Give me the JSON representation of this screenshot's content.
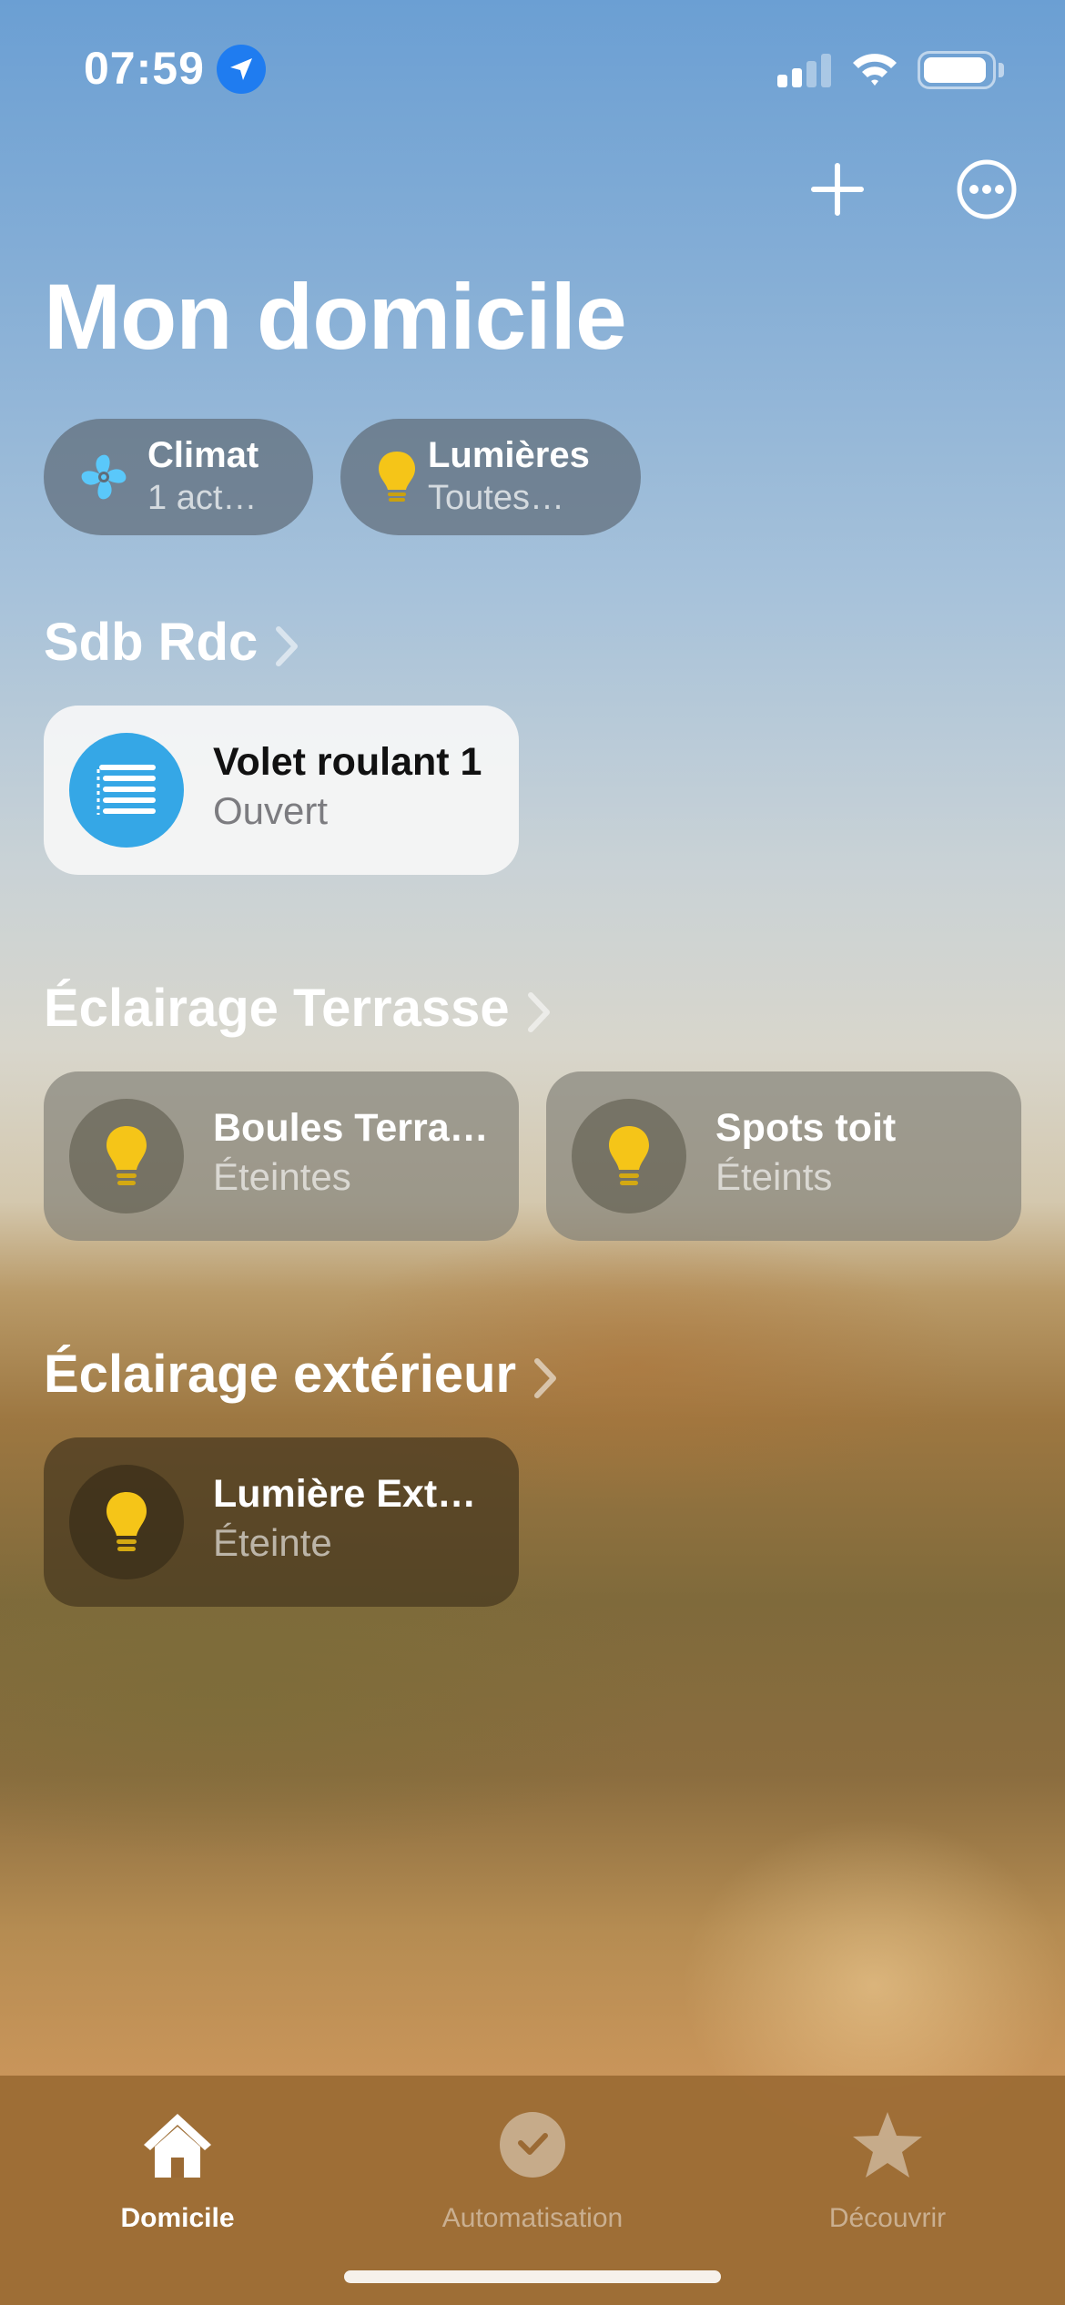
{
  "status_bar": {
    "time": "07:59",
    "signal_bars_active": 2,
    "signal_bars_total": 4,
    "battery_level": 0.95
  },
  "header": {
    "title": "Mon domicile",
    "add_icon": "plus-icon",
    "more_icon": "ellipsis-circle-icon"
  },
  "chips": [
    {
      "title": "Climat",
      "subtitle": "1 act…",
      "icon": "fan-icon"
    },
    {
      "title": "Lumières",
      "subtitle": "Toutes…",
      "icon": "lightbulb-icon"
    }
  ],
  "rooms": [
    {
      "title": "Sdb Rdc",
      "accessories": [
        {
          "name": "Volet roulant 1",
          "state": "Ouvert",
          "icon": "window-blind-icon"
        }
      ]
    },
    {
      "title": "Éclairage Terrasse",
      "accessories": [
        {
          "name": "Boules Terra…",
          "state": "Éteintes",
          "icon": "lightbulb-icon"
        },
        {
          "name": "Spots toit",
          "state": "Éteints",
          "icon": "lightbulb-icon"
        }
      ]
    },
    {
      "title": "Éclairage extérieur",
      "accessories": [
        {
          "name": "Lumière Ext…",
          "state": "Éteinte",
          "icon": "lightbulb-icon"
        }
      ]
    }
  ],
  "tab_bar": {
    "tabs": [
      {
        "label": "Domicile",
        "icon": "house-icon",
        "active": true
      },
      {
        "label": "Automatisation",
        "icon": "clock-check-icon",
        "active": false
      },
      {
        "label": "Découvrir",
        "icon": "star-icon",
        "active": false
      }
    ]
  },
  "colors": {
    "bulb_yellow": "#f5c518",
    "blind_blue": "#35a7e6",
    "fan_blue": "#5ac8fa",
    "location_blue": "#1f7cf0"
  }
}
